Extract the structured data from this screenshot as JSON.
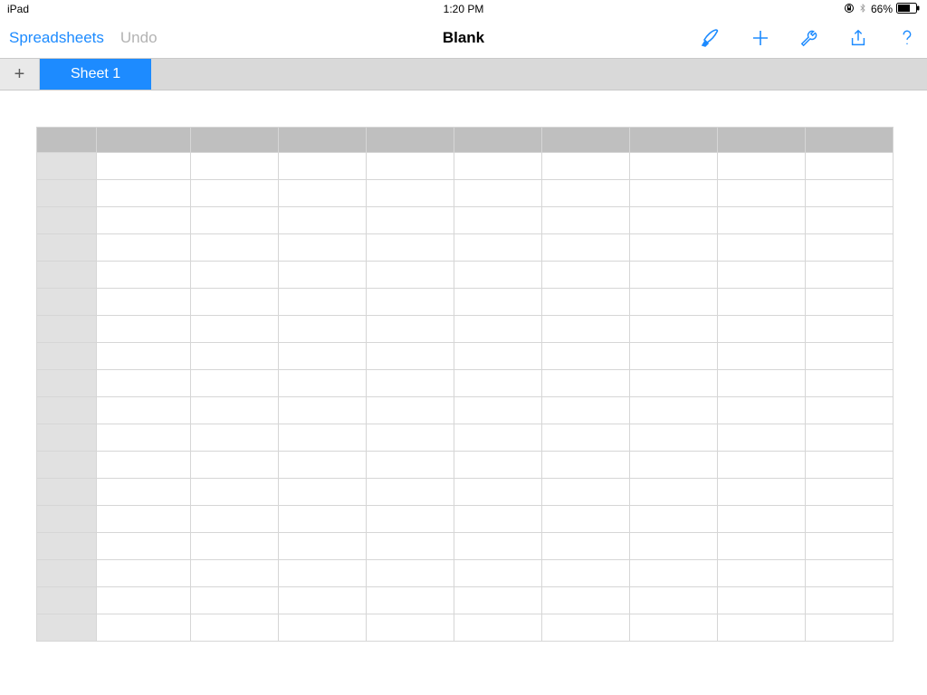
{
  "statusbar": {
    "device": "iPad",
    "time": "1:20 PM",
    "battery_pct": "66%",
    "lock_icon": "orientation-lock",
    "bt_icon": "bluetooth"
  },
  "navbar": {
    "back_label": "Spreadsheets",
    "undo_label": "Undo",
    "title": "Blank",
    "icons": {
      "paint": "format-paintbrush",
      "plus": "insert",
      "wrench": "tools",
      "share": "share",
      "help": "help"
    }
  },
  "tabstrip": {
    "add_label": "+",
    "tabs": [
      {
        "label": "Sheet 1",
        "active": true
      }
    ]
  },
  "grid": {
    "columns": 9,
    "rows": 18
  }
}
